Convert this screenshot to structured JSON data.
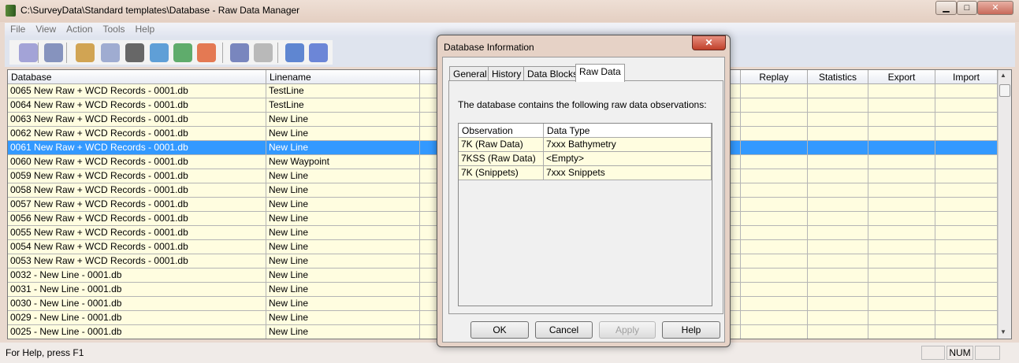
{
  "window": {
    "title": "C:\\SurveyData\\Standard templates\\Database - Raw Data Manager",
    "minimize": "▁",
    "maximize": "□",
    "close": "✕"
  },
  "menu": [
    "File",
    "View",
    "Action",
    "Tools",
    "Help"
  ],
  "toolbar": [
    "new-database-icon",
    "open-database-icon",
    "user-icon",
    "inspect-icon",
    "waterfall-icon",
    "layers-icon",
    "chart-icon",
    "export-icon",
    "database-info-icon",
    "print-icon",
    "checklist-icon",
    "help-pointer-icon"
  ],
  "grid": {
    "headers": [
      "Database",
      "Linename",
      "",
      "Replay",
      "Statistics",
      "Export",
      "Import"
    ],
    "rows": [
      [
        "0065 New Raw  + WCD Records - 0001.db",
        "TestLine"
      ],
      [
        "0064 New Raw  + WCD Records - 0001.db",
        "TestLine"
      ],
      [
        "0063 New Raw  + WCD Records - 0001.db",
        "New Line"
      ],
      [
        "0062 New Raw  + WCD Records - 0001.db",
        "New Line"
      ],
      [
        "0061 New Raw  + WCD Records - 0001.db",
        "New Line"
      ],
      [
        "0060 New Raw  + WCD Records - 0001.db",
        "New Waypoint"
      ],
      [
        "0059 New Raw  + WCD Records - 0001.db",
        "New Line"
      ],
      [
        "0058 New Raw  + WCD Records - 0001.db",
        "New Line"
      ],
      [
        "0057 New Raw  + WCD Records - 0001.db",
        "New Line"
      ],
      [
        "0056 New Raw  + WCD Records - 0001.db",
        "New Line"
      ],
      [
        "0055 New Raw  + WCD Records - 0001.db",
        "New Line"
      ],
      [
        "0054 New Raw  + WCD Records - 0001.db",
        "New Line"
      ],
      [
        "0053 New Raw  + WCD Records - 0001.db",
        "New Line"
      ],
      [
        "0032 - New Line - 0001.db",
        "New Line"
      ],
      [
        "0031 - New Line - 0001.db",
        "New Line"
      ],
      [
        "0030 - New Line - 0001.db",
        "New Line"
      ],
      [
        "0029 - New Line - 0001.db",
        "New Line"
      ],
      [
        "0025 - New Line - 0001.db",
        "New Line"
      ]
    ],
    "selected_index": 4
  },
  "status": {
    "help": "For Help, press F1",
    "num": "NUM"
  },
  "dialog": {
    "title": "Database Information",
    "close": "✕",
    "tabs": [
      "General",
      "History",
      "Data Blocks",
      "Raw Data"
    ],
    "active_tab": "Raw Data",
    "text": "The database contains the following raw data observations:",
    "columns": [
      "Observation",
      "Data Type"
    ],
    "rows": [
      [
        "7K (Raw Data)",
        "7xxx Bathymetry"
      ],
      [
        "7KSS (Raw Data)",
        "<Empty>"
      ],
      [
        "7K (Snippets)",
        "7xxx Snippets"
      ]
    ],
    "buttons": {
      "ok": "OK",
      "cancel": "Cancel",
      "apply": "Apply",
      "help": "Help"
    }
  },
  "colors": {
    "selection": "#3399ff",
    "row_bg": "#fffde0"
  }
}
